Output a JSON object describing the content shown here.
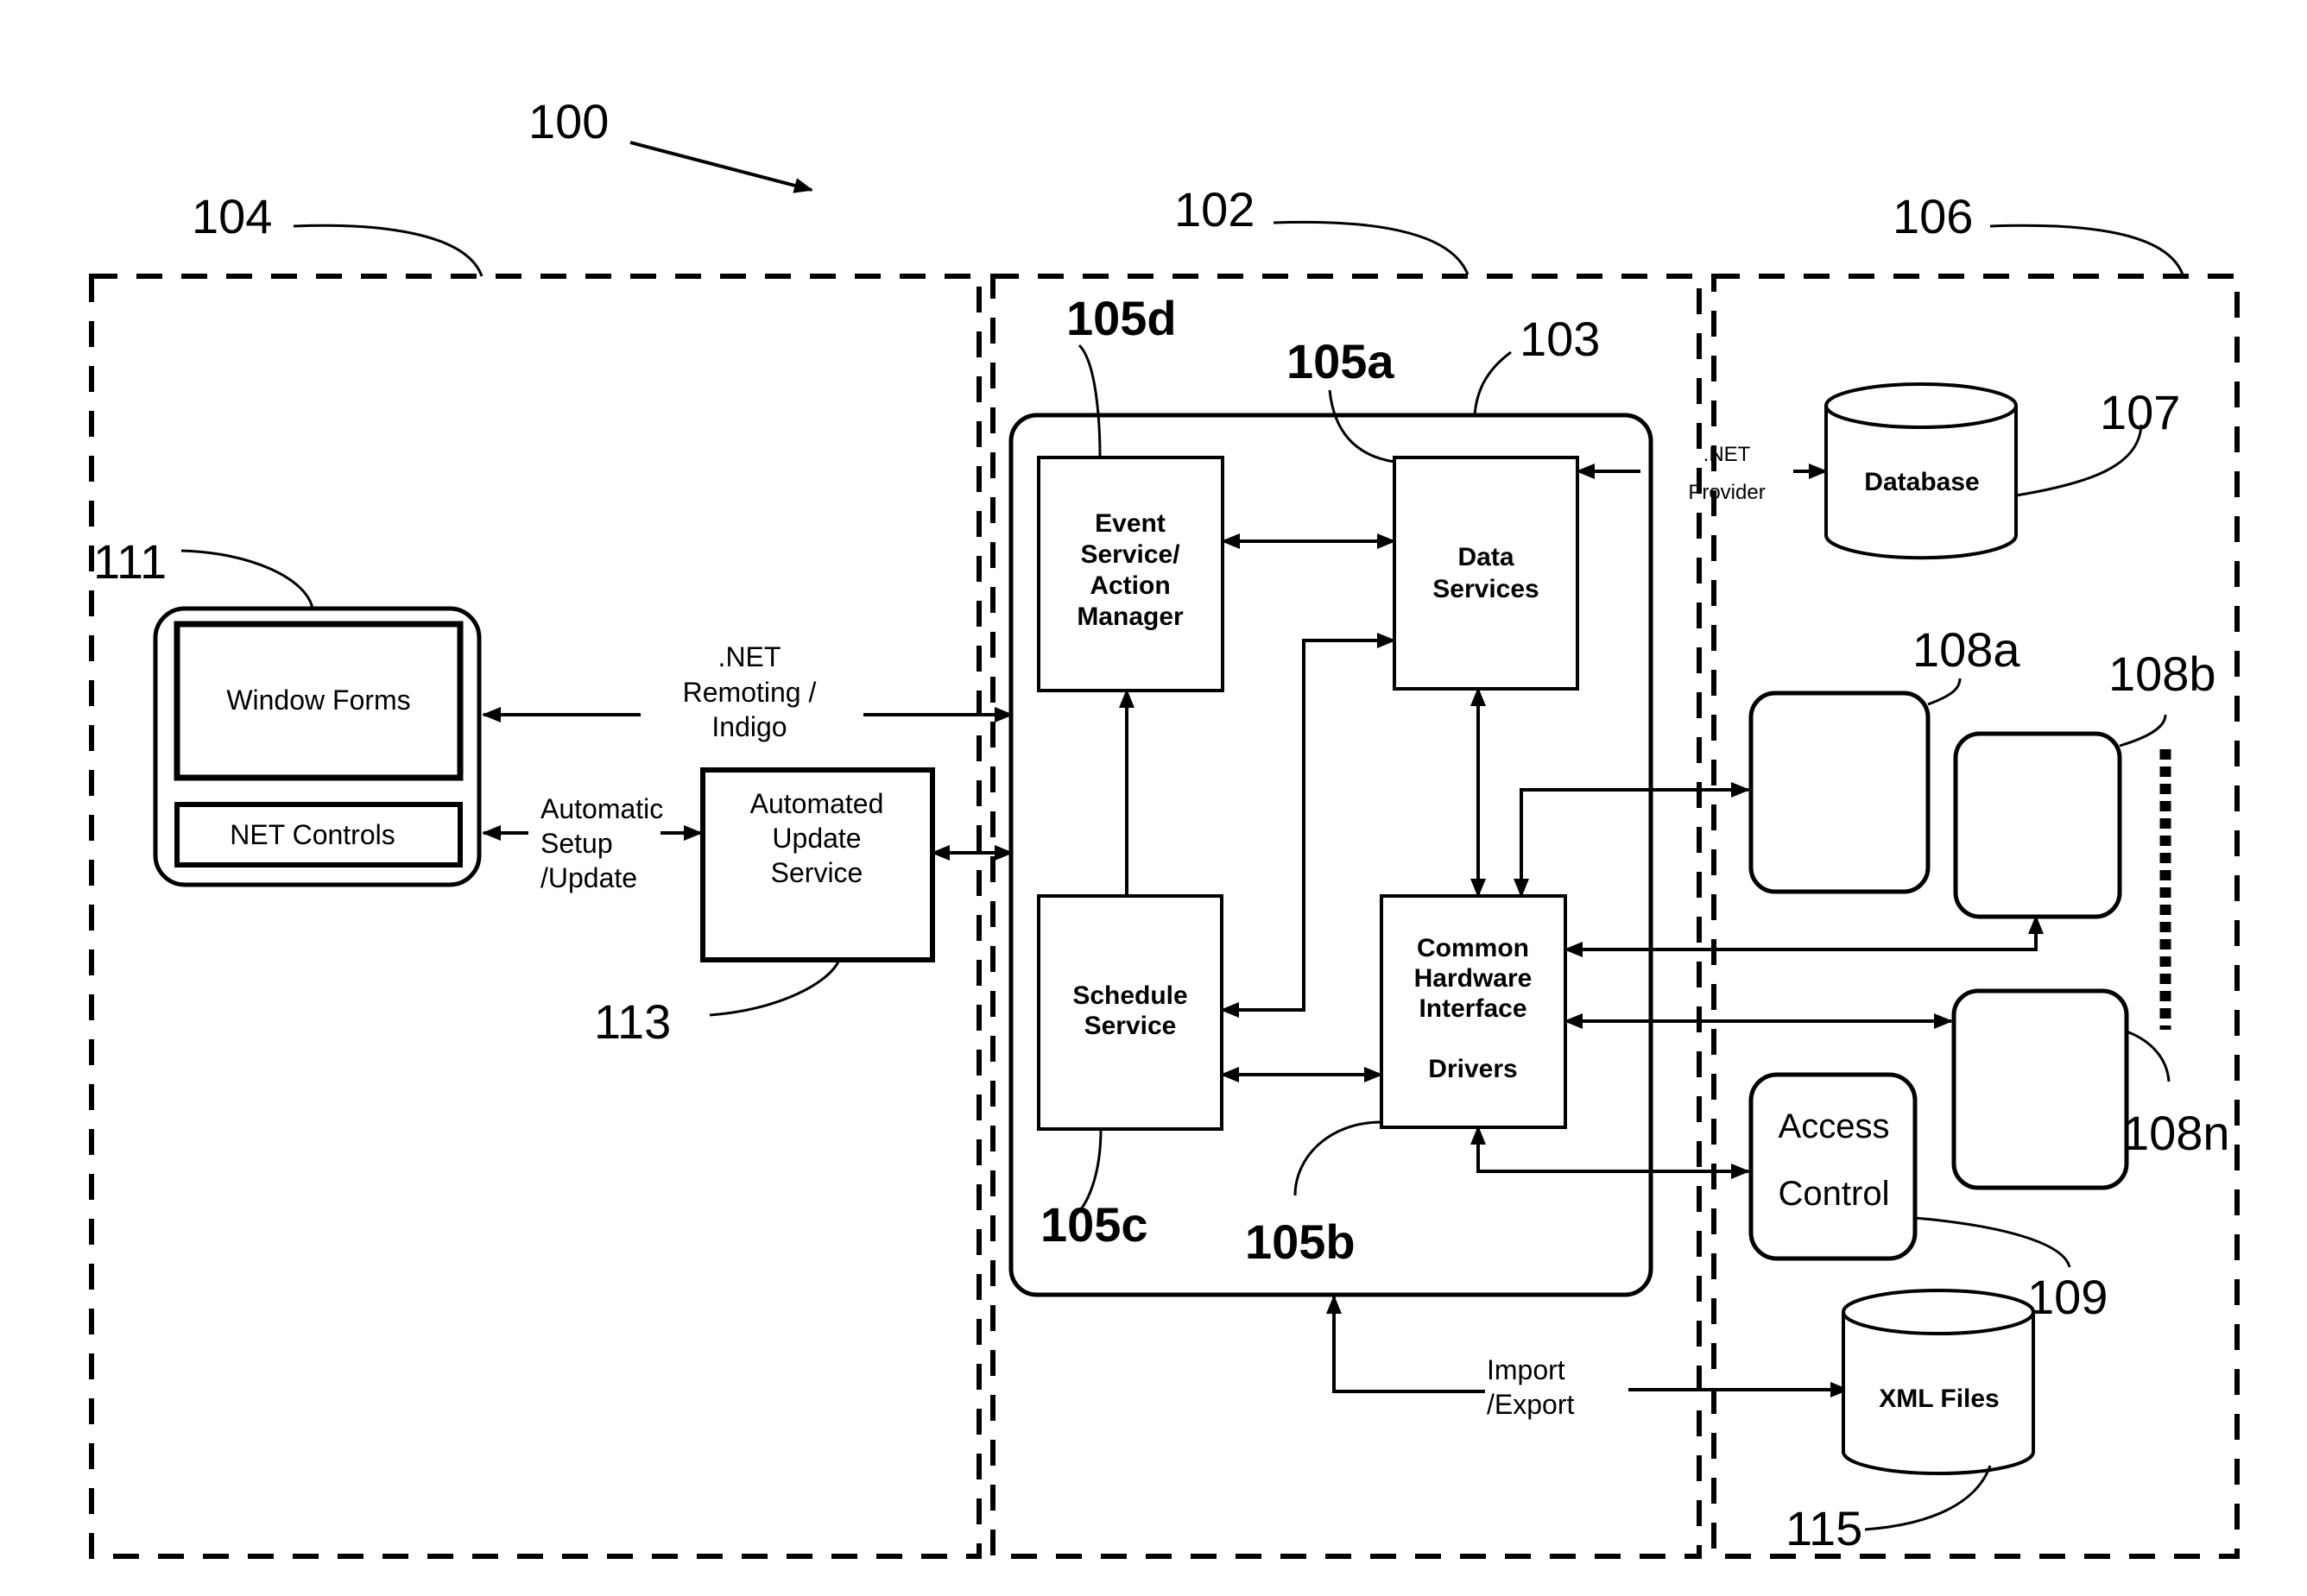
{
  "figure": {
    "ref_overall": "100",
    "regions": {
      "client": "104",
      "server": "102",
      "hardware": "106"
    }
  },
  "client": {
    "app_ref": "111",
    "window_forms": "Window Forms",
    "net_controls": "NET Controls",
    "remoting_label": [
      ".NET",
      "Remoting /",
      "Indigo"
    ],
    "setup_label": [
      "Automatic",
      "Setup",
      "/Update"
    ],
    "update_service": [
      "Automated",
      "Update",
      "Service"
    ],
    "update_service_ref": "113"
  },
  "server": {
    "core_ref": "103",
    "event_service": {
      "ref": "105d",
      "lines": [
        "Event",
        "Service/",
        "Action",
        "Manager"
      ]
    },
    "data_services": {
      "ref": "105a",
      "lines": [
        "Data",
        "Services"
      ]
    },
    "schedule_service": {
      "ref": "105c",
      "lines": [
        "Schedule",
        "Service"
      ]
    },
    "hardware_interface": {
      "ref": "105b",
      "lines": [
        "Common",
        "Hardware",
        "Interface",
        "",
        "Drivers"
      ]
    },
    "provider_label": [
      ".NET",
      "Provider"
    ],
    "import_export_label": [
      "Import",
      "/Export"
    ]
  },
  "hardware": {
    "database": {
      "label": "Database",
      "ref": "107"
    },
    "devices": [
      {
        "ref": "108a"
      },
      {
        "ref": "108b"
      },
      {
        "ref": "108n"
      }
    ],
    "access_control": {
      "lines": [
        "Access",
        "Control"
      ],
      "ref": "109"
    },
    "xml_files": {
      "label": "XML Files",
      "ref": "115"
    }
  }
}
